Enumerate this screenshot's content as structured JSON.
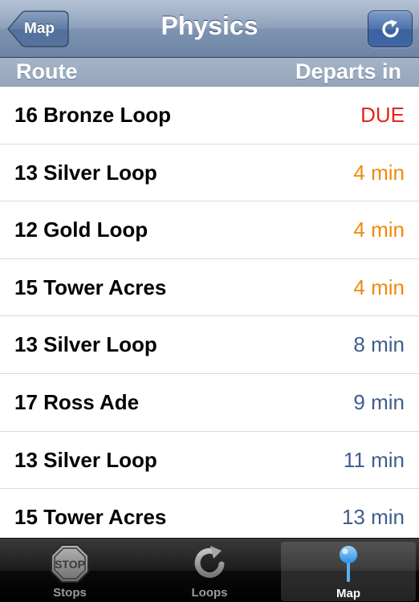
{
  "navbar": {
    "title": "Physics",
    "back_label": "Map",
    "refresh_icon": "refresh-icon"
  },
  "header": {
    "route": "Route",
    "departs": "Departs in"
  },
  "rows": [
    {
      "route": "16 Bronze Loop",
      "departs": "DUE",
      "color": "#e2261c"
    },
    {
      "route": "13 Silver Loop",
      "departs": "4 min",
      "color": "#f08a0a"
    },
    {
      "route": "12 Gold Loop",
      "departs": "4 min",
      "color": "#f08a0a"
    },
    {
      "route": "15 Tower Acres",
      "departs": "4 min",
      "color": "#f08a0a"
    },
    {
      "route": "13 Silver Loop",
      "departs": "8 min",
      "color": "#3f5d8e"
    },
    {
      "route": "17 Ross Ade",
      "departs": "9 min",
      "color": "#3f5d8e"
    },
    {
      "route": "13 Silver Loop",
      "departs": "11 min",
      "color": "#3f5d8e"
    },
    {
      "route": "15 Tower Acres",
      "departs": "13 min",
      "color": "#3f5d8e"
    }
  ],
  "tabs": [
    {
      "label": "Stops",
      "icon": "stop-sign-icon",
      "active": false
    },
    {
      "label": "Loops",
      "icon": "loop-arrow-icon",
      "active": false
    },
    {
      "label": "Map",
      "icon": "map-pin-icon",
      "active": true
    }
  ]
}
